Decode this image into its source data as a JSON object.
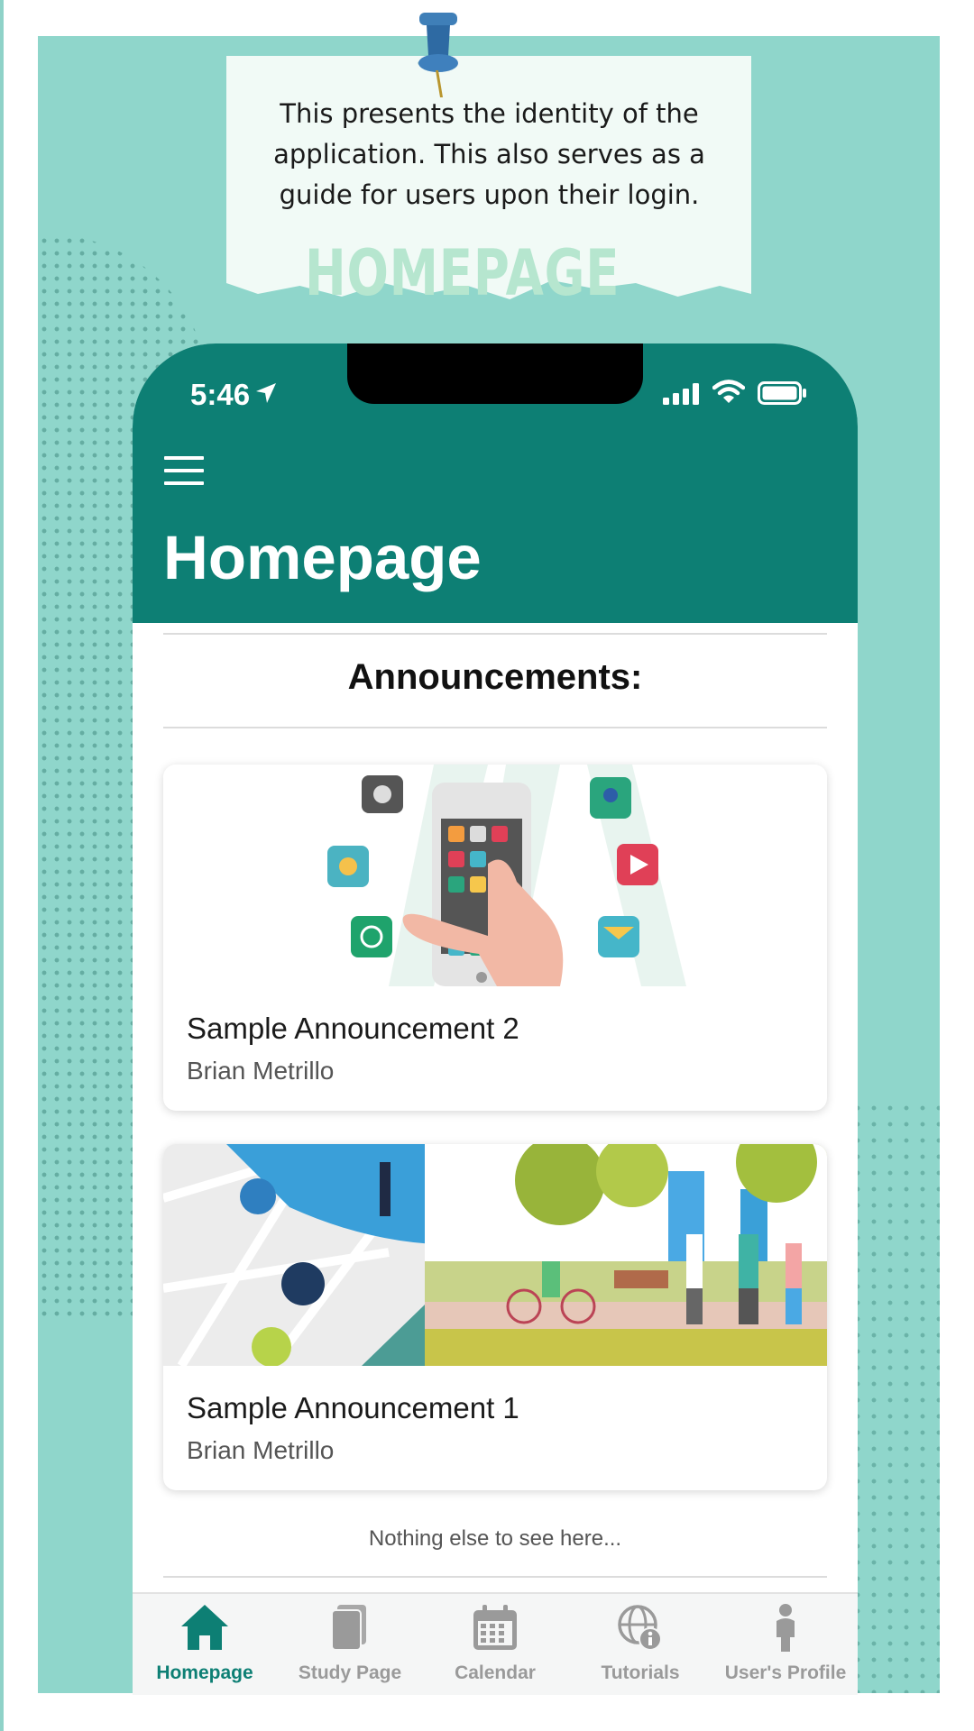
{
  "note": {
    "description": "This presents the identity of the application. This also serves as a guide for users upon their login.",
    "title": "HOMEPAGE"
  },
  "status_bar": {
    "time": "5:46",
    "icons": [
      "location-arrow-icon",
      "signal-icon",
      "wifi-icon",
      "battery-icon"
    ]
  },
  "header": {
    "menu_icon": "hamburger-menu-icon",
    "title": "Homepage",
    "color": "#0d7f74"
  },
  "section": {
    "title": "Announcements:"
  },
  "announcements": [
    {
      "title": "Sample Announcement 2",
      "author": "Brian Metrillo",
      "image": "smartphone-apps-illustration"
    },
    {
      "title": "Sample Announcement 1",
      "author": "Brian Metrillo",
      "image": "city-park-map-illustration"
    }
  ],
  "footer_note": "Nothing else to see here...",
  "tabs": [
    {
      "label": "Homepage",
      "icon": "home-icon",
      "active": true
    },
    {
      "label": "Study Page",
      "icon": "book-icon",
      "active": false
    },
    {
      "label": "Calendar",
      "icon": "calendar-icon",
      "active": false
    },
    {
      "label": "Tutorials",
      "icon": "globe-info-icon",
      "active": false
    },
    {
      "label": "User's Profile",
      "icon": "person-icon",
      "active": false
    }
  ],
  "colors": {
    "background": "#8fd6cb",
    "accent": "#0d7f74",
    "note_title": "#b6e6cf",
    "inactive_tab": "#9a9a9a"
  }
}
